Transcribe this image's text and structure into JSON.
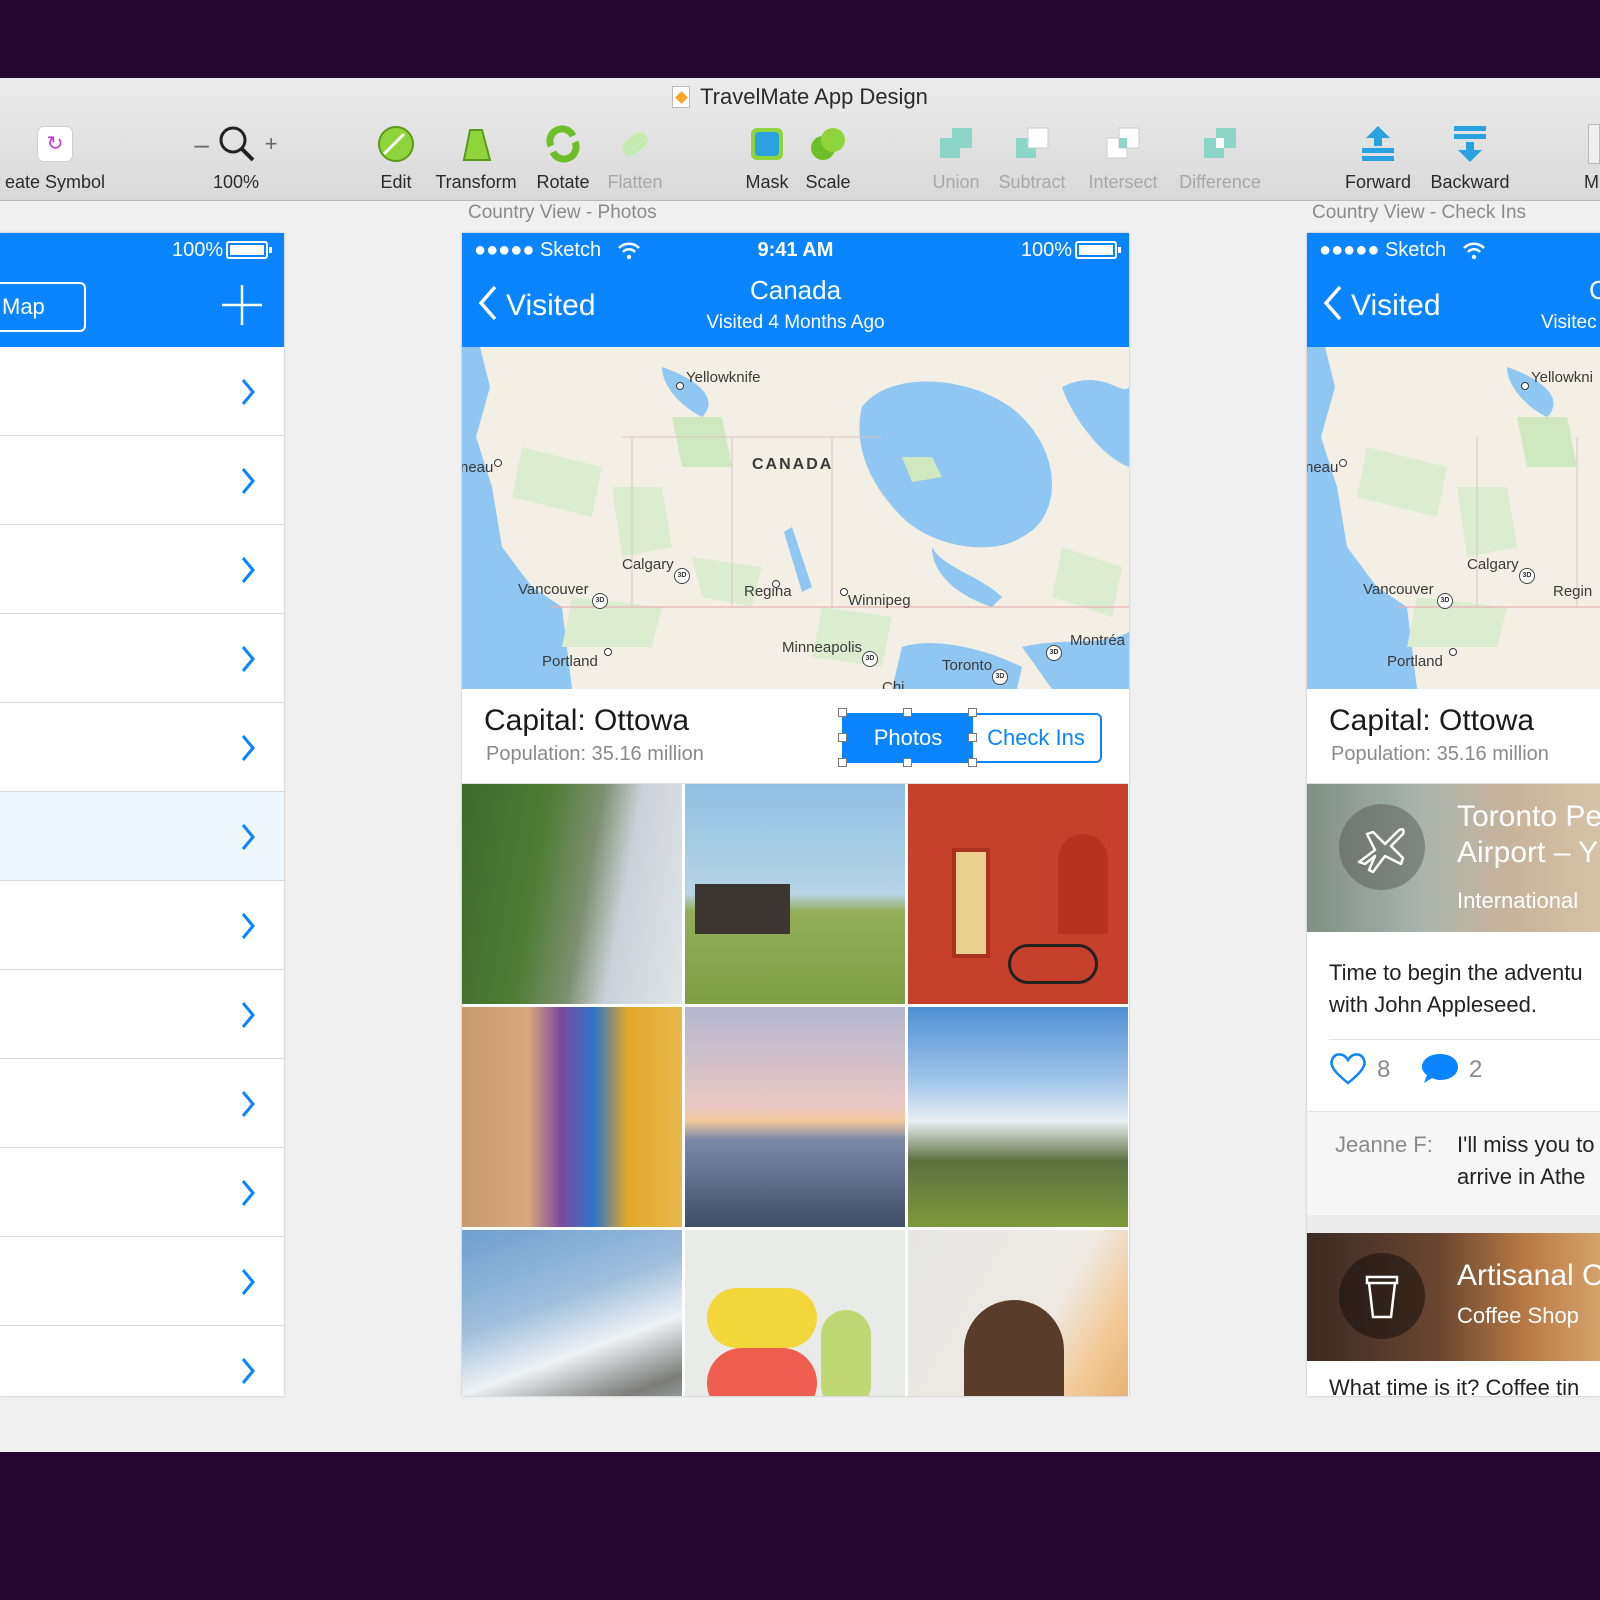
{
  "window": {
    "title": "TravelMate App Design"
  },
  "toolbar": {
    "create_symbol": "eate Symbol",
    "zoom_value": "100%",
    "edit": "Edit",
    "transform": "Transform",
    "rotate": "Rotate",
    "flatten": "Flatten",
    "mask": "Mask",
    "scale": "Scale",
    "union": "Union",
    "subtract": "Subtract",
    "intersect": "Intersect",
    "difference": "Difference",
    "forward": "Forward",
    "backward": "Backward",
    "more": "M"
  },
  "artboards": {
    "center_label": "Country View - Photos",
    "right_label": "Country View - Check Ins"
  },
  "left_screen": {
    "battery": "100%",
    "map_button": "Map",
    "add_icon": "plus-icon",
    "rows": 12,
    "highlighted_row": 6
  },
  "center_screen": {
    "carrier": "●●●●● Sketch",
    "time": "9:41 AM",
    "battery": "100%",
    "back_label": "Visited",
    "title": "Canada",
    "subtitle": "Visited 4 Months Ago",
    "map": {
      "country": "CANADA",
      "cities": [
        "Yellowknife",
        "neau",
        "Calgary",
        "Vancouver",
        "Regina",
        "Winnipeg",
        "Portland",
        "Minneapolis",
        "Toronto",
        "Montréa",
        "Chi"
      ]
    },
    "capital": "Capital: Ottowa",
    "population": "Population: 35.16 million",
    "segment_photos": "Photos",
    "segment_checkins": "Check Ins",
    "photos": [
      "coastline",
      "barn",
      "red-door-bicycle",
      "mural",
      "sunset-mountains",
      "snowy-peaks",
      "alpine-snow",
      "macarons",
      "portrait"
    ]
  },
  "right_screen": {
    "carrier": "●●●●● Sketch",
    "back_label": "Visited",
    "title_partial": "C",
    "subtitle_partial": "Visitec",
    "map_cities": [
      "Yellowkni",
      "neau",
      "Calgary",
      "Vancouver",
      "Regin",
      "Portland"
    ],
    "capital": "Capital: Ottowa",
    "population": "Population: 35.16 million",
    "card1": {
      "title_line1": "Toronto Pe",
      "title_line2": "Airport – Y",
      "subtitle": "International",
      "body_line1": "Time to begin the adventu",
      "body_line2": "with John Appleseed.",
      "likes": "8",
      "comments": "2",
      "comment_author": "Jeanne F:",
      "comment_line1": "I'll miss you to",
      "comment_line2": "arrive in Athe"
    },
    "card2": {
      "title": "Artisanal C",
      "subtitle": "Coffee Shop",
      "body": "What time is it? Coffee tin"
    }
  },
  "colors": {
    "accent": "#0a84ff",
    "background": "#23072e",
    "canvas": "#f0f0f0"
  }
}
